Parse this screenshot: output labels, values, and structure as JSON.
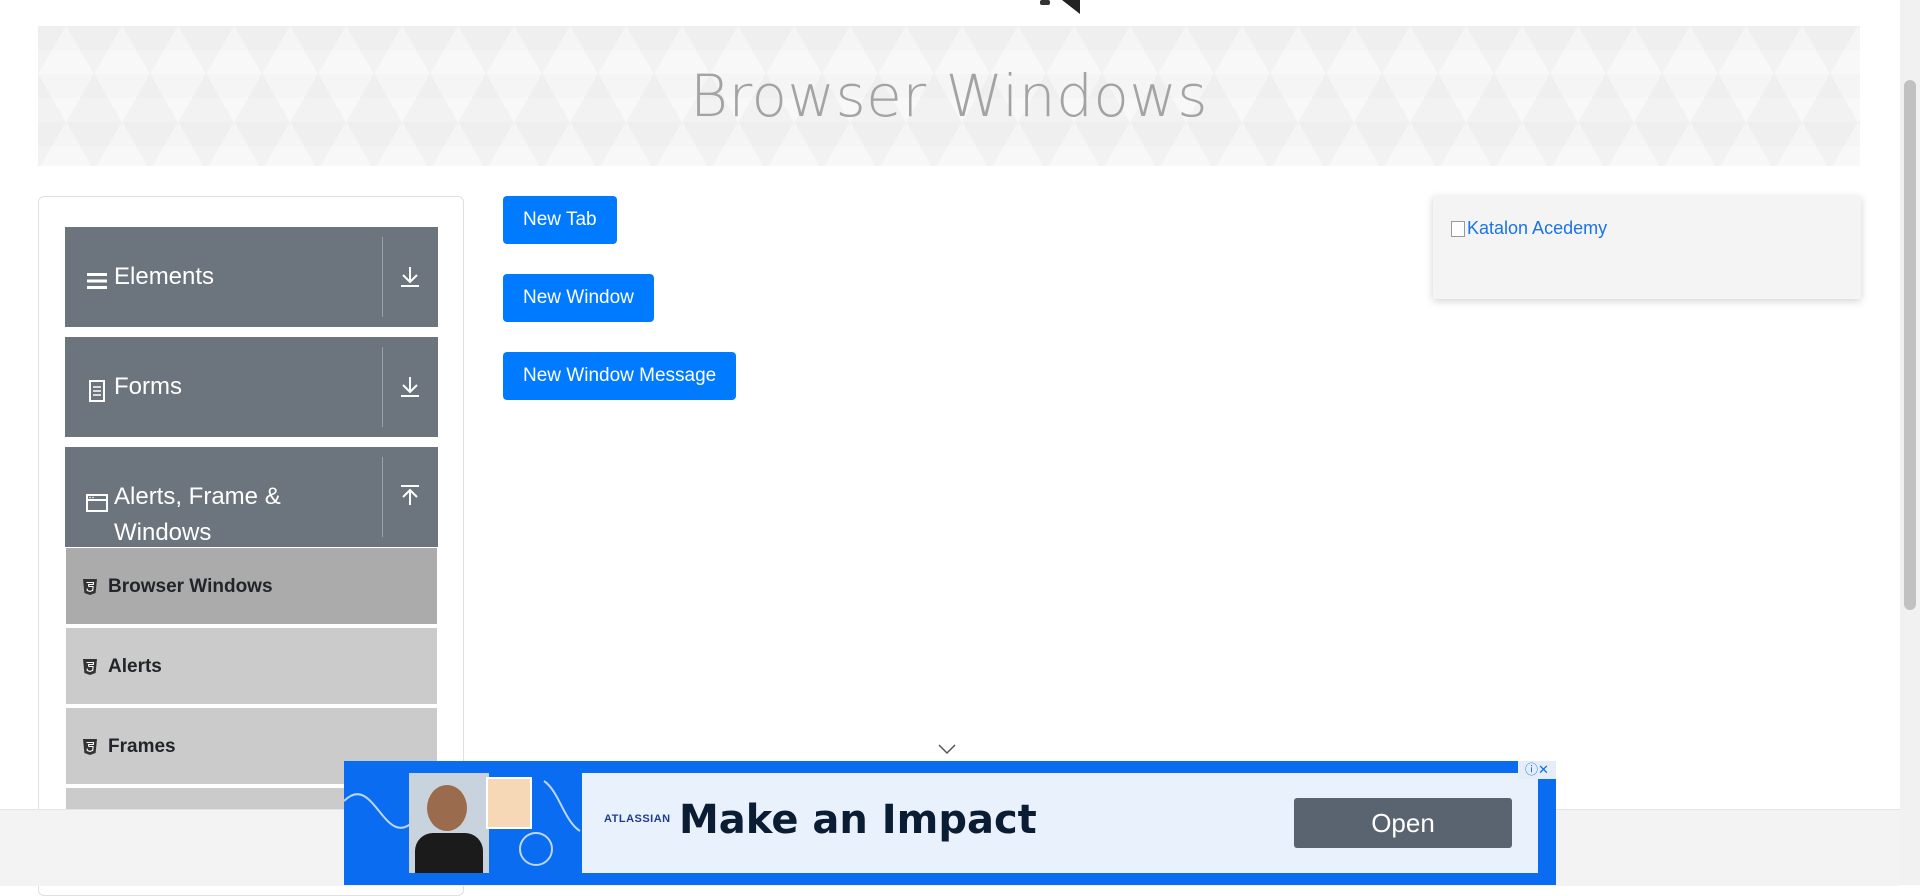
{
  "header": {
    "title": "Browser Windows"
  },
  "sidebar": {
    "groups": [
      {
        "label": "Elements",
        "icon": "menu-icon",
        "expanded": false
      },
      {
        "label": "Forms",
        "icon": "document-icon",
        "expanded": false
      },
      {
        "label": "Alerts, Frame & Windows",
        "label_line1": "Alerts, Frame &",
        "label_line2": "Windows",
        "icon": "window-icon",
        "expanded": true
      }
    ],
    "items": [
      {
        "label": "Browser Windows",
        "active": true
      },
      {
        "label": "Alerts",
        "active": false
      },
      {
        "label": "Frames",
        "active": false
      }
    ]
  },
  "main": {
    "buttons": {
      "new_tab": "New Tab",
      "new_window": "New Window",
      "new_window_message": "New Window Message"
    }
  },
  "side_ad": {
    "alt_text": "Katalon Acedemy"
  },
  "bottom_ad": {
    "brand": "ATLASSIAN",
    "headline": "Make an Impact",
    "cta": "Open",
    "adchoices": "ⓘ✕"
  },
  "colors": {
    "primary": "#007bff",
    "sidebar_header": "#6c757d",
    "sidebar_item": "#cbcbcb",
    "sidebar_item_active": "#ababab",
    "ad_blue": "#0a6cf0"
  }
}
